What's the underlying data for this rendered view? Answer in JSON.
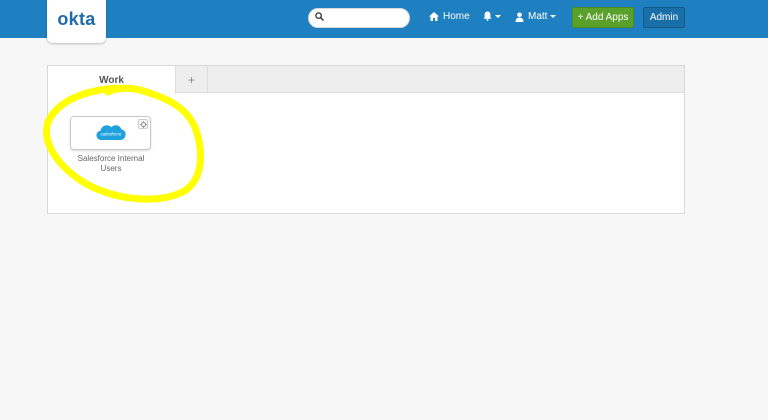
{
  "header": {
    "logo_text": "okta",
    "search": {
      "value": "",
      "placeholder": ""
    },
    "nav": {
      "home_label": "Home",
      "user_label": "Matt"
    },
    "add_apps_label": "+ Add Apps",
    "admin_label": "Admin"
  },
  "tabs": [
    {
      "label": "Work",
      "active": true
    },
    {
      "label": "+",
      "active": false
    }
  ],
  "apps": [
    {
      "name": "Salesforce Internal Users",
      "logo_text": "salesforce"
    }
  ],
  "colors": {
    "header_bg": "#1f80c1",
    "add_apps_bg": "#5aa12c",
    "admin_bg": "#1a6fa8",
    "salesforce_blue": "#1ea1dc",
    "highlight": "#ffff00"
  },
  "icons": [
    "search-icon",
    "home-icon",
    "bell-icon",
    "user-icon",
    "gear-icon",
    "salesforce-logo-icon"
  ]
}
